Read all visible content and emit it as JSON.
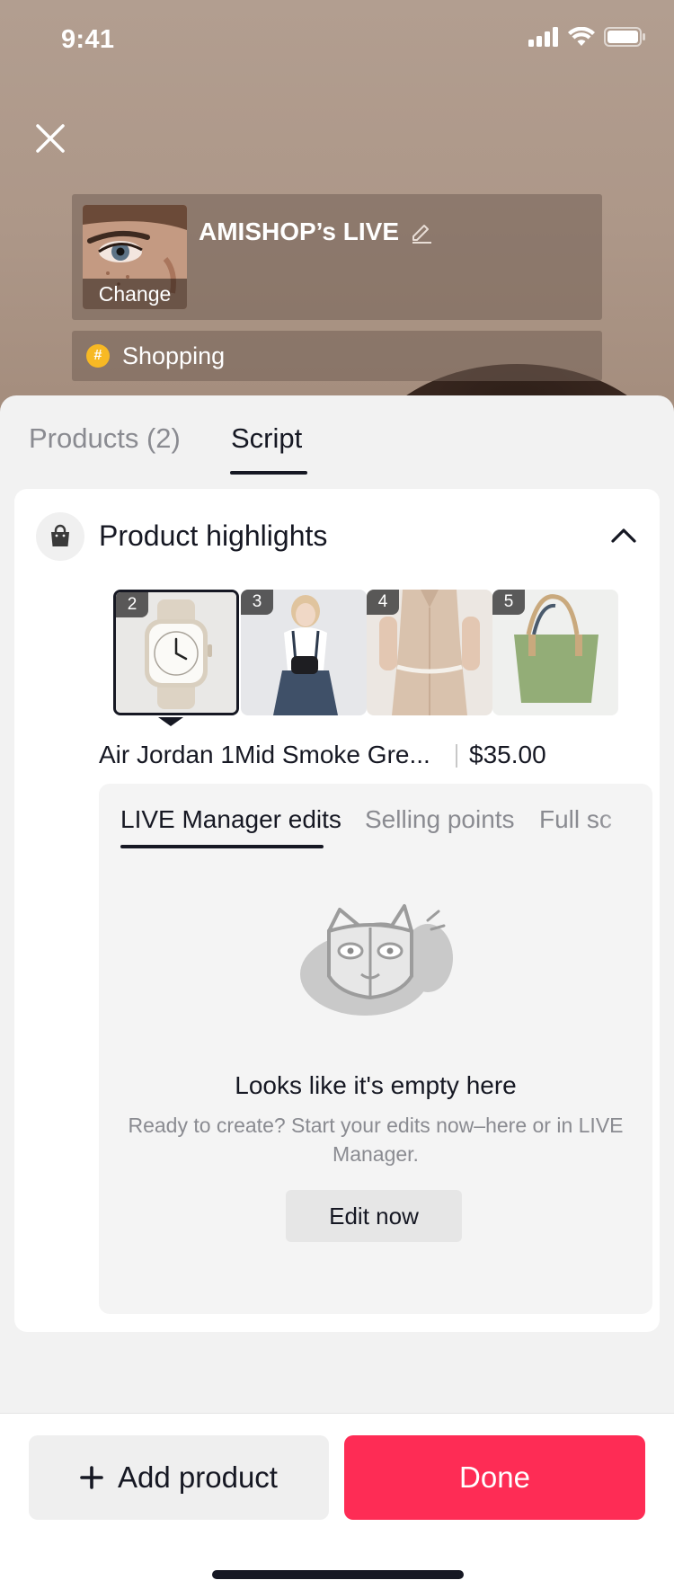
{
  "status_bar": {
    "time": "9:41"
  },
  "live_setup": {
    "title": "AMISHOP’s LIVE",
    "cover_change_label": "Change",
    "topic": "Shopping"
  },
  "tabs": [
    {
      "label": "Products (2)",
      "active": false
    },
    {
      "label": "Script",
      "active": true
    }
  ],
  "highlights": {
    "title": "Product highlights",
    "thumbnails": [
      {
        "number": "2",
        "name": "watch-thumbnail",
        "selected": true
      },
      {
        "number": "3",
        "name": "outfit-thumbnail",
        "selected": false
      },
      {
        "number": "4",
        "name": "dress-thumbnail",
        "selected": false
      },
      {
        "number": "5",
        "name": "tote-bag-thumbnail",
        "selected": false
      }
    ],
    "selected_product": {
      "name": "Air Jordan 1Mid Smoke Gre...",
      "price": "$35.00"
    },
    "subtabs": [
      {
        "label": "LIVE Manager edits",
        "active": true
      },
      {
        "label": "Selling points",
        "active": false
      },
      {
        "label": "Full sc",
        "active": false
      }
    ],
    "empty_state": {
      "title": "Looks like it's empty here",
      "description": "Ready to create? Start your edits now–here or in LIVE Manager.",
      "button_label": "Edit now"
    }
  },
  "actions": {
    "add_product_label": "Add product",
    "done_label": "Done"
  },
  "colors": {
    "accent": "#fe2c55",
    "text_primary": "#161823",
    "text_secondary": "#8a8b91",
    "topic_icon": "#f7b924"
  }
}
